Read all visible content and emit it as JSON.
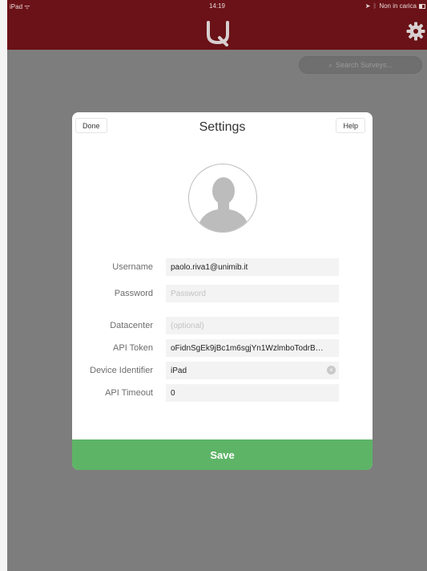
{
  "status": {
    "device": "iPad",
    "time": "14:19",
    "charging": "Non in carica"
  },
  "header": {
    "logo_icon": "q-logo-icon",
    "settings_icon": "gear-icon"
  },
  "search": {
    "placeholder": "Search Surveys..."
  },
  "modal": {
    "title": "Settings",
    "done_label": "Done",
    "help_label": "Help",
    "avatar_icon": "user-avatar-icon",
    "fields": {
      "username": {
        "label": "Username",
        "value": "paolo.riva1@unimib.it"
      },
      "password": {
        "label": "Password",
        "placeholder": "Password"
      },
      "datacenter": {
        "label": "Datacenter",
        "placeholder": "(optional)"
      },
      "api_token": {
        "label": "API Token",
        "value": "oFidnSgEk9jBc1m6sgjYn1WzlmboTodrB…"
      },
      "device_identifier": {
        "label": "Device Identifier",
        "value": "iPad"
      },
      "api_timeout": {
        "label": "API Timeout",
        "value": "0"
      }
    },
    "save_label": "Save"
  },
  "colors": {
    "header": "#6a1217",
    "backdrop": "#7d7d7d",
    "save": "#5db466"
  }
}
